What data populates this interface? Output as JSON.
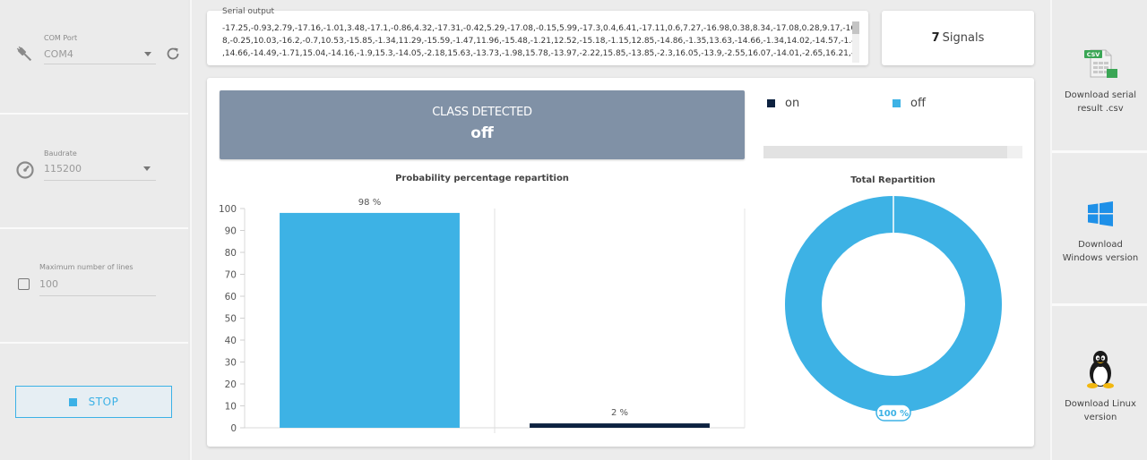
{
  "left_panel": {
    "com_port": {
      "label": "COM Port",
      "value": "COM4"
    },
    "baudrate": {
      "label": "Baudrate",
      "value": "115200"
    },
    "max_lines": {
      "label": "Maximum number of lines",
      "value": "100",
      "checked": false
    },
    "stop_button": {
      "label": "STOP"
    }
  },
  "serial_output": {
    "title": "Serial output",
    "lines": [
      "-17.25,-0.93,2.79,-17.16,-1.01,3.48,-17.1,-0.86,4.32,-17.31,-0.42,5.29,-17.08,-0.15,5.99,-17.3,0.4,6.41,-17.11,0.6,7.27,-16.98,0.38,8.34,-17.08,0.28,9.17,-16.5",
      "8,-0.25,10.03,-16.2,-0.7,10.53,-15.85,-1.34,11.29,-15.59,-1.47,11.96,-15.48,-1.21,12.52,-15.18,-1.15,12.85,-14.86,-1.35,13.63,-14.66,-1.34,14.02,-14.57,-1.42",
      ",14.66,-14.49,-1.71,15.04,-14.16,-1.9,15.3,-14.05,-2.18,15.63,-13.73,-1.98,15.78,-13.97,-2.22,15.85,-13.85,-2.3,16.05,-13.9,-2.55,16.07,-14.01,-2.65,16.21,-1"
    ]
  },
  "signals": {
    "count": "7",
    "label": "Signals"
  },
  "class_detected": {
    "title": "CLASS DETECTED",
    "value": "off"
  },
  "legend": [
    {
      "name": "on",
      "color": "#0d2240"
    },
    {
      "name": "off",
      "color": "#3db2e5"
    }
  ],
  "progress": {
    "fraction": 0.94
  },
  "downloads": {
    "csv": {
      "label_line1": "Download serial",
      "label_line2": "result .csv",
      "icon": "csv-file-icon",
      "badge": "CSV"
    },
    "windows": {
      "label_line1": "Download",
      "label_line2": "Windows version",
      "icon": "windows-logo-icon"
    },
    "linux": {
      "label_line1": "Download Linux",
      "label_line2": "version",
      "icon": "linux-tux-icon"
    }
  },
  "chart_data": [
    {
      "type": "bar",
      "title": "Probability percentage repartition",
      "categories": [
        "off",
        "on"
      ],
      "values": [
        98,
        2
      ],
      "data_labels": [
        "98 %",
        "2 %"
      ],
      "colors": [
        "#3db2e5",
        "#0d2240"
      ],
      "ylim": [
        0,
        100
      ],
      "yticks": [
        0,
        10,
        20,
        30,
        40,
        50,
        60,
        70,
        80,
        90,
        100
      ],
      "grid": false
    },
    {
      "type": "pie",
      "title": "Total Repartition",
      "labels": [
        "off",
        "on"
      ],
      "values": [
        100,
        0
      ],
      "data_label": "100 %",
      "colors": [
        "#3db2e5",
        "#0d2240"
      ],
      "donut": true
    }
  ]
}
